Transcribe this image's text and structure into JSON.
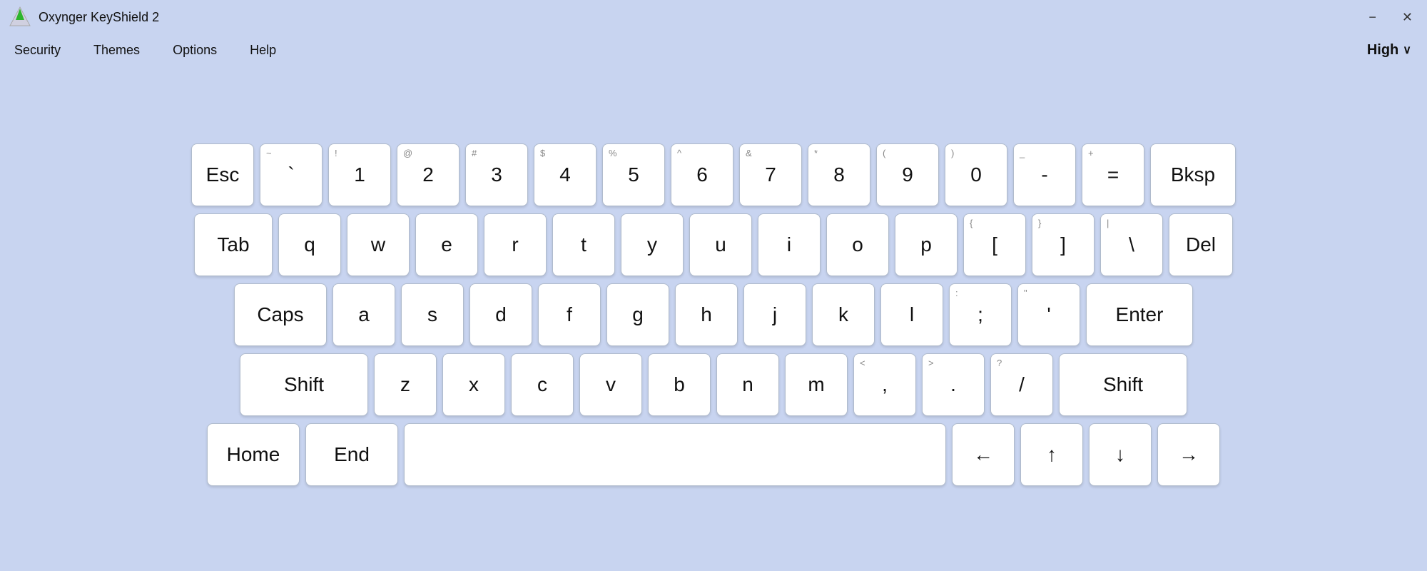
{
  "titleBar": {
    "title": "Oxynger KeyShield 2",
    "minimizeLabel": "−",
    "closeLabel": "✕"
  },
  "menuBar": {
    "items": [
      "Security",
      "Themes",
      "Options",
      "Help"
    ],
    "securityLevel": "High",
    "chevron": "∨"
  },
  "keyboard": {
    "rows": [
      [
        {
          "main": "Esc",
          "cls": "key-esc"
        },
        {
          "top": "~",
          "main": "`",
          "cls": ""
        },
        {
          "top": "!",
          "main": "1",
          "cls": ""
        },
        {
          "top": "@",
          "main": "2",
          "cls": ""
        },
        {
          "top": "#",
          "main": "3",
          "cls": ""
        },
        {
          "top": "$",
          "main": "4",
          "cls": ""
        },
        {
          "top": "%",
          "main": "5",
          "cls": ""
        },
        {
          "top": "^",
          "main": "6",
          "cls": ""
        },
        {
          "top": "&",
          "main": "7",
          "cls": ""
        },
        {
          "top": "*",
          "main": "8",
          "cls": ""
        },
        {
          "top": "(",
          "main": "9",
          "cls": ""
        },
        {
          "top": ")",
          "main": "0",
          "cls": ""
        },
        {
          "top": "_",
          "main": "-",
          "cls": ""
        },
        {
          "top": "+",
          "main": "=",
          "cls": ""
        },
        {
          "main": "Bksp",
          "cls": "key-bksp"
        }
      ],
      [
        {
          "main": "Tab",
          "cls": "key-tab"
        },
        {
          "main": "q",
          "cls": ""
        },
        {
          "main": "w",
          "cls": ""
        },
        {
          "main": "e",
          "cls": ""
        },
        {
          "main": "r",
          "cls": ""
        },
        {
          "main": "t",
          "cls": ""
        },
        {
          "main": "y",
          "cls": ""
        },
        {
          "main": "u",
          "cls": ""
        },
        {
          "main": "i",
          "cls": ""
        },
        {
          "main": "o",
          "cls": ""
        },
        {
          "main": "p",
          "cls": ""
        },
        {
          "top": "{",
          "main": "[",
          "cls": ""
        },
        {
          "top": "}",
          "main": "]",
          "cls": ""
        },
        {
          "top": "|",
          "main": "\\",
          "cls": ""
        },
        {
          "main": "Del",
          "cls": "key-del"
        }
      ],
      [
        {
          "main": "Caps",
          "cls": "key-caps"
        },
        {
          "main": "a",
          "cls": ""
        },
        {
          "main": "s",
          "cls": ""
        },
        {
          "main": "d",
          "cls": ""
        },
        {
          "main": "f",
          "cls": ""
        },
        {
          "main": "g",
          "cls": ""
        },
        {
          "main": "h",
          "cls": ""
        },
        {
          "main": "j",
          "cls": ""
        },
        {
          "main": "k",
          "cls": ""
        },
        {
          "main": "l",
          "cls": ""
        },
        {
          "top": ":",
          "main": ";",
          "cls": ""
        },
        {
          "top": "\"",
          "main": "'",
          "cls": ""
        },
        {
          "main": "Enter",
          "cls": "key-enter"
        }
      ],
      [
        {
          "main": "Shift",
          "cls": "key-shift-l"
        },
        {
          "main": "z",
          "cls": ""
        },
        {
          "main": "x",
          "cls": ""
        },
        {
          "main": "c",
          "cls": ""
        },
        {
          "main": "v",
          "cls": ""
        },
        {
          "main": "b",
          "cls": ""
        },
        {
          "main": "n",
          "cls": ""
        },
        {
          "main": "m",
          "cls": ""
        },
        {
          "top": "<",
          "main": ",",
          "cls": ""
        },
        {
          "top": ">",
          "main": ".",
          "cls": ""
        },
        {
          "top": "?",
          "main": "/",
          "cls": ""
        },
        {
          "main": "Shift",
          "cls": "key-shift-r"
        }
      ],
      [
        {
          "main": "Home",
          "cls": "key-home"
        },
        {
          "main": "End",
          "cls": "key-end"
        },
        {
          "main": "",
          "cls": "key-space"
        },
        {
          "main": "←",
          "cls": "key-arrow"
        },
        {
          "main": "↑",
          "cls": "key-arrow"
        },
        {
          "main": "↓",
          "cls": "key-arrow"
        },
        {
          "main": "→",
          "cls": "key-arrow"
        }
      ]
    ]
  }
}
